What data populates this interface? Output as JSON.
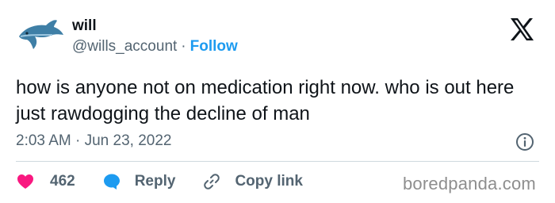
{
  "author": {
    "name": "will",
    "handle": "@wills_account",
    "separator": "·",
    "follow_label": "Follow",
    "avatar_icon": "dolphin-icon"
  },
  "tweet": {
    "text": "how is anyone not on medication right now. who is out here just rawdogging the decline of man",
    "timestamp": "2:03 AM · Jun 23, 2022"
  },
  "actions": {
    "like_count": "462",
    "reply_label": "Reply",
    "copy_label": "Copy link"
  },
  "watermark": "boredpanda.com",
  "colors": {
    "text": "#0f1419",
    "muted": "#536471",
    "accent": "#1d9bf0",
    "like": "#f91880",
    "reply_icon": "#1d9bf0",
    "divider": "#cfd9de"
  },
  "icons": {
    "brand": "x-logo-icon",
    "info": "info-icon",
    "like": "heart-icon",
    "reply": "speech-bubble-icon",
    "copy": "link-icon"
  }
}
